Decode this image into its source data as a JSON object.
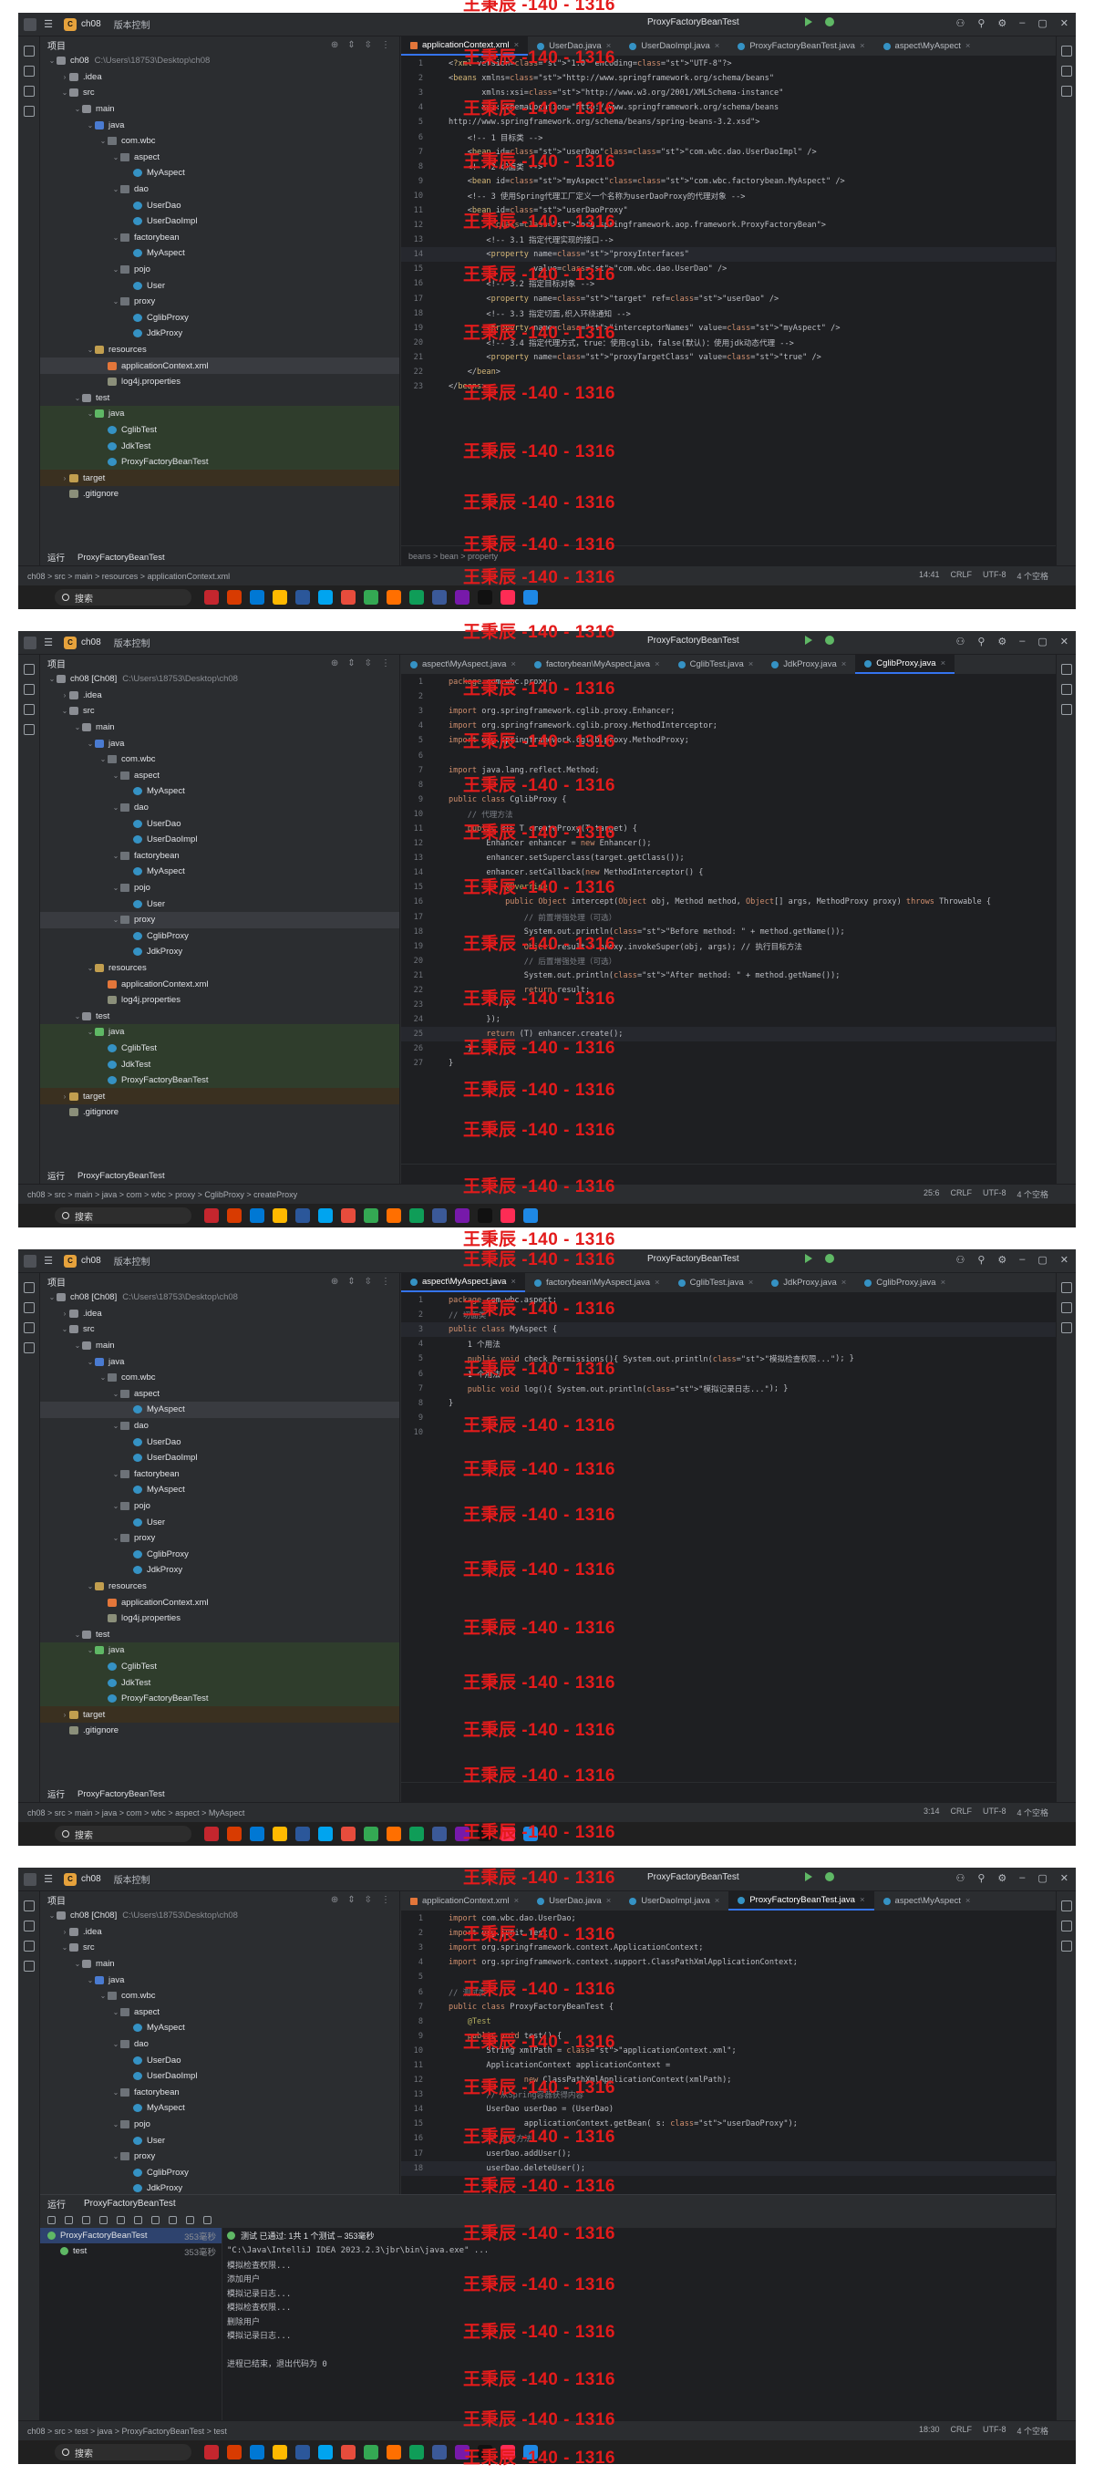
{
  "title_bar": {
    "project": "ch08",
    "project_badge": "C",
    "vcs": "版本控制",
    "run_config": "ProxyFactoryBeanTest"
  },
  "sidebar_panel_title": "项目",
  "tree": [
    {
      "indent": 0,
      "arrow": "v",
      "icon": "folder",
      "label": "ch08",
      "sub": "C:\\Users\\18753\\Desktop\\ch08",
      "cls": ""
    },
    {
      "indent": 1,
      "arrow": ">",
      "icon": "folder",
      "label": ".idea",
      "cls": ""
    },
    {
      "indent": 1,
      "arrow": "v",
      "icon": "folder",
      "label": "src",
      "cls": ""
    },
    {
      "indent": 2,
      "arrow": "v",
      "icon": "folder",
      "label": "main",
      "cls": ""
    },
    {
      "indent": 3,
      "arrow": "v",
      "icon": "src",
      "label": "java",
      "cls": ""
    },
    {
      "indent": 4,
      "arrow": "v",
      "icon": "pkg",
      "label": "com.wbc",
      "cls": ""
    },
    {
      "indent": 5,
      "arrow": "v",
      "icon": "pkg",
      "label": "aspect",
      "cls": ""
    },
    {
      "indent": 6,
      "arrow": "",
      "icon": "cls",
      "label": "MyAspect",
      "cls": ""
    },
    {
      "indent": 5,
      "arrow": "v",
      "icon": "pkg",
      "label": "dao",
      "cls": ""
    },
    {
      "indent": 6,
      "arrow": "",
      "icon": "cls",
      "label": "UserDao",
      "cls": ""
    },
    {
      "indent": 6,
      "arrow": "",
      "icon": "cls",
      "label": "UserDaoImpl",
      "cls": ""
    },
    {
      "indent": 5,
      "arrow": "v",
      "icon": "pkg",
      "label": "factorybean",
      "cls": ""
    },
    {
      "indent": 6,
      "arrow": "",
      "icon": "cls",
      "label": "MyAspect",
      "cls": ""
    },
    {
      "indent": 5,
      "arrow": "v",
      "icon": "pkg",
      "label": "pojo",
      "cls": ""
    },
    {
      "indent": 6,
      "arrow": "",
      "icon": "cls",
      "label": "User",
      "cls": ""
    },
    {
      "indent": 5,
      "arrow": "v",
      "icon": "pkg",
      "label": "proxy",
      "cls": ""
    },
    {
      "indent": 6,
      "arrow": "",
      "icon": "cls",
      "label": "CglibProxy",
      "cls": ""
    },
    {
      "indent": 6,
      "arrow": "",
      "icon": "cls",
      "label": "JdkProxy",
      "cls": ""
    },
    {
      "indent": 3,
      "arrow": "v",
      "icon": "res",
      "label": "resources",
      "cls": ""
    },
    {
      "indent": 4,
      "arrow": "",
      "icon": "xml",
      "label": "applicationContext.xml",
      "cls": ""
    },
    {
      "indent": 4,
      "arrow": "",
      "icon": "prop",
      "label": "log4j.properties",
      "cls": ""
    },
    {
      "indent": 2,
      "arrow": "v",
      "icon": "folder",
      "label": "test",
      "cls": ""
    },
    {
      "indent": 3,
      "arrow": "v",
      "icon": "test",
      "label": "java",
      "cls": "test"
    },
    {
      "indent": 4,
      "arrow": "",
      "icon": "cls",
      "label": "CglibTest",
      "cls": "test"
    },
    {
      "indent": 4,
      "arrow": "",
      "icon": "cls",
      "label": "JdkTest",
      "cls": "test"
    },
    {
      "indent": 4,
      "arrow": "",
      "icon": "cls",
      "label": "ProxyFactoryBeanTest",
      "cls": "test"
    },
    {
      "indent": 1,
      "arrow": ">",
      "icon": "res",
      "label": "target",
      "cls": "target"
    },
    {
      "indent": 1,
      "arrow": "",
      "icon": "prop",
      "label": ".gitignore",
      "cls": ""
    }
  ],
  "panels": [
    {
      "root_label": "ch08",
      "selected_index": 19,
      "tabs": [
        {
          "label": "applicationContext.xml",
          "type": "xml",
          "active": true
        },
        {
          "label": "UserDao.java",
          "type": "java",
          "active": false
        },
        {
          "label": "UserDaoImpl.java",
          "type": "java",
          "active": false
        },
        {
          "label": "ProxyFactoryBeanTest.java",
          "type": "java",
          "active": false
        },
        {
          "label": "aspect\\MyAspect",
          "type": "java",
          "active": false
        }
      ],
      "code": [
        "<?xml version=\"1.0\" encoding=\"UTF-8\"?>",
        "<beans xmlns=\"http://www.springframework.org/schema/beans\"",
        "       xmlns:xsi=\"http://www.w3.org/2001/XMLSchema-instance\"",
        "       xsi:schemaLocation=\"http://www.springframework.org/schema/beans",
        "http://www.springframework.org/schema/beans/spring-beans-3.2.xsd\">",
        "    <!-- 1 目标类 -->",
        "    <bean id=\"userDao\" class=\"com.wbc.dao.UserDaoImpl\" />",
        "    <!-- 2 切面类 -->",
        "    <bean id=\"myAspect\" class=\"com.wbc.factorybean.MyAspect\" />",
        "    <!-- 3 使用Spring代理工厂定义一个名称为userDaoProxy的代理对象 -->",
        "    <bean id=\"userDaoProxy\"",
        "          class=\"org.springframework.aop.framework.ProxyFactoryBean\">",
        "        <!-- 3.1 指定代理实现的接口-->",
        "        <property name=\"proxyInterfaces\"",
        "                  value=\"com.wbc.dao.UserDao\" />",
        "        <!-- 3.2 指定目标对象 -->",
        "        <property name=\"target\" ref=\"userDao\" />",
        "        <!-- 3.3 指定切面,织入环绕通知 -->",
        "        <property name=\"interceptorNames\" value=\"myAspect\" />",
        "        <!-- 3.4 指定代理方式，true：使用cglib，false(默认)：使用jdk动态代理 -->",
        "        <property name=\"proxyTargetClass\" value=\"true\" />",
        "    </bean>",
        "</beans>"
      ],
      "cursor_line": 14,
      "foot_crumb": "beans  >  bean  >  property",
      "run_label": "运行",
      "run_config": "ProxyFactoryBeanTest",
      "status_crumb": "ch08 > src > main > resources > applicationContext.xml",
      "status_pos": "14:41",
      "has_runpanel": false
    },
    {
      "root_label": "ch08 [Ch08]",
      "selected_index": 15,
      "tabs": [
        {
          "label": "aspect\\MyAspect.java",
          "type": "java",
          "active": false
        },
        {
          "label": "factorybean\\MyAspect.java",
          "type": "java",
          "active": false
        },
        {
          "label": "CglibTest.java",
          "type": "java",
          "active": false
        },
        {
          "label": "JdkProxy.java",
          "type": "java",
          "active": false
        },
        {
          "label": "CglibProxy.java",
          "type": "java",
          "active": true
        }
      ],
      "code": [
        "package com.wbc.proxy;",
        "",
        "import org.springframework.cglib.proxy.Enhancer;",
        "import org.springframework.cglib.proxy.MethodInterceptor;",
        "import org.springframework.cglib.proxy.MethodProxy;",
        "",
        "import java.lang.reflect.Method;",
        "",
        "public class CglibProxy {",
        "    // 代理方法",
        "    public <T> T createProxy(T target) {",
        "        Enhancer enhancer = new Enhancer();",
        "        enhancer.setSuperclass(target.getClass());",
        "        enhancer.setCallback(new MethodInterceptor() {",
        "            @Override",
        "            public Object intercept(Object obj, Method method, Object[] args, MethodProxy proxy) throws Throwable {",
        "                // 前置增强处理（可选）",
        "                System.out.println(\"Before method: \" + method.getName());",
        "                Object result = proxy.invokeSuper(obj, args); // 执行目标方法",
        "                // 后置增强处理（可选）",
        "                System.out.println(\"After method: \" + method.getName());",
        "                return result;",
        "            }",
        "        });",
        "        return (T) enhancer.create();",
        "    }",
        "}"
      ],
      "cursor_line": 25,
      "foot_crumb": "",
      "run_label": "运行",
      "run_config": "ProxyFactoryBeanTest",
      "status_crumb": "ch08 > src > main > java > com > wbc > proxy > CglibProxy > createProxy",
      "status_pos": "25:6",
      "has_runpanel": false
    },
    {
      "root_label": "ch08 [Ch08]",
      "selected_index": 7,
      "tabs": [
        {
          "label": "aspect\\MyAspect.java",
          "type": "java",
          "active": true
        },
        {
          "label": "factorybean\\MyAspect.java",
          "type": "java",
          "active": false
        },
        {
          "label": "CglibTest.java",
          "type": "java",
          "active": false
        },
        {
          "label": "JdkProxy.java",
          "type": "java",
          "active": false
        },
        {
          "label": "CglibProxy.java",
          "type": "java",
          "active": false
        }
      ],
      "code": [
        "package com.wbc.aspect;",
        "// 切面类",
        "public class MyAspect {",
        "    1 个用法",
        "    public void check_Permissions(){ System.out.println(\"模拟检查权限...\"); }",
        "    1 个用法",
        "    public void log(){ System.out.println(\"模拟记录日志...\"); }",
        "}",
        "",
        ""
      ],
      "cursor_line": 3,
      "foot_crumb": "",
      "run_label": "运行",
      "run_config": "ProxyFactoryBeanTest",
      "status_crumb": "ch08 > src > main > java > com > wbc > aspect > MyAspect",
      "status_pos": "3:14",
      "has_runpanel": false
    },
    {
      "root_label": "ch08 [Ch08]",
      "selected_index": -1,
      "tabs": [
        {
          "label": "applicationContext.xml",
          "type": "xml",
          "active": false
        },
        {
          "label": "UserDao.java",
          "type": "java",
          "active": false
        },
        {
          "label": "UserDaoImpl.java",
          "type": "java",
          "active": false
        },
        {
          "label": "ProxyFactoryBeanTest.java",
          "type": "java",
          "active": true
        },
        {
          "label": "aspect\\MyAspect",
          "type": "java",
          "active": false
        }
      ],
      "code": [
        "import com.wbc.dao.UserDao;",
        "import org.junit.Test;",
        "import org.springframework.context.ApplicationContext;",
        "import org.springframework.context.support.ClassPathXmlApplicationContext;",
        "",
        "// 测试类",
        "public class ProxyFactoryBeanTest {",
        "    @Test",
        "    public void test() {",
        "        String xmlPath = \"applicationContext.xml\";",
        "        ApplicationContext applicationContext =",
        "                new ClassPathXmlApplicationContext(xmlPath);",
        "        // 从Spring容器获得内容",
        "        UserDao userDao = (UserDao)",
        "                applicationContext.getBean( s: \"userDaoProxy\");",
        "        // 执行方法",
        "        userDao.addUser();",
        "        userDao.deleteUser();"
      ],
      "cursor_line": 18,
      "foot_crumb": "",
      "run_label": "运行",
      "run_config": "ProxyFactoryBeanTest",
      "status_crumb": "ch08 > src > test > java > ProxyFactoryBeanTest > test",
      "status_pos": "18:30",
      "has_runpanel": true,
      "runpanel": {
        "title": "运行",
        "config": "ProxyFactoryBeanTest",
        "tests": [
          {
            "name": "ProxyFactoryBeanTest",
            "time": "353毫秒",
            "sel": true
          },
          {
            "name": "test",
            "time": "353毫秒",
            "sel": false
          }
        ],
        "status": "测试 已通过: 1共 1 个测试 – 353毫秒",
        "output": [
          "\"C:\\Java\\IntelliJ IDEA 2023.2.3\\jbr\\bin\\java.exe\" ...",
          "模拟检查权限...",
          "添加用户",
          "模拟记录日志...",
          "模拟检查权限...",
          "删除用户",
          "模拟记录日志...",
          "",
          "进程已结束，退出代码为 0"
        ]
      }
    }
  ],
  "status_right": {
    "line_sep": "CRLF",
    "encoding": "UTF-8",
    "indent": "4 个空格"
  },
  "taskbar": {
    "search_placeholder": "搜索"
  },
  "watermark": "王秉辰 -140 - 1316",
  "colors": {
    "accent": "#3574f0",
    "watermark": "#e31b1b",
    "editor_bg": "#1e1f22",
    "chrome_bg": "#2b2d30"
  }
}
